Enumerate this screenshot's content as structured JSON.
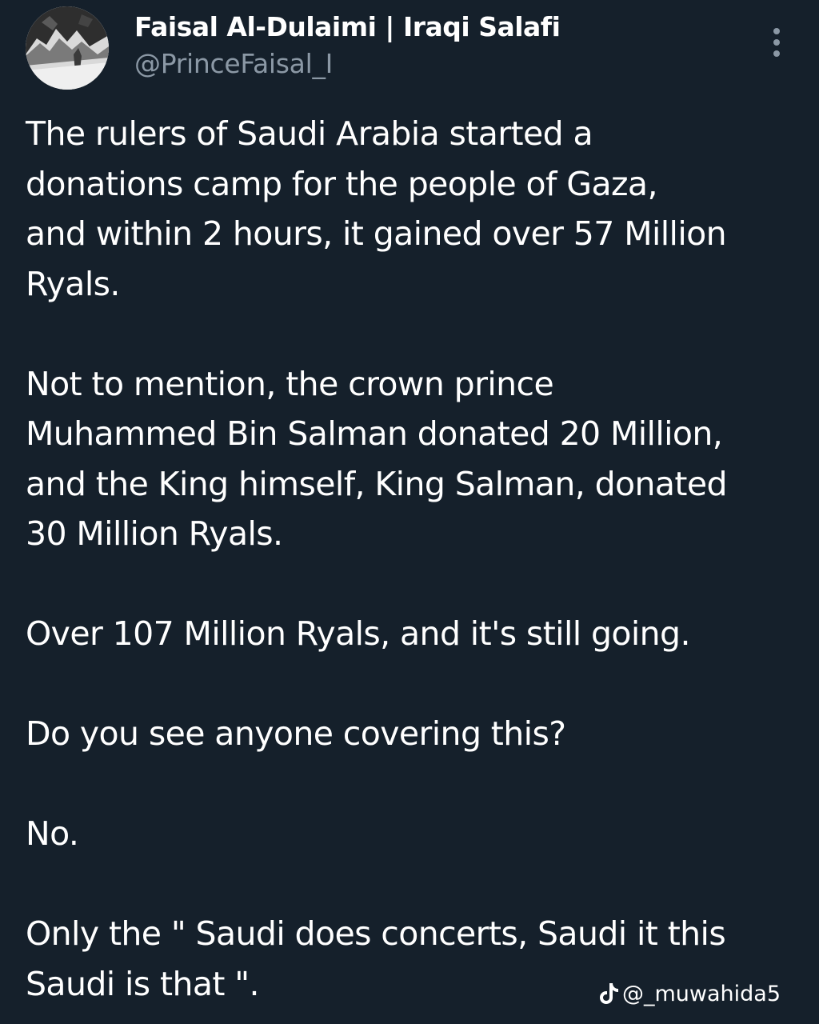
{
  "author": {
    "display_name": "Faisal Al-Dulaimi | Iraqi Salafi",
    "handle": "@PrinceFaisal_I",
    "avatar_icon": "profile-photo-icon"
  },
  "menu": {
    "icon": "more-vertical-icon"
  },
  "tweet": {
    "paragraphs": [
      "The rulers of Saudi Arabia started a\ndonations camp for the people of Gaza,\nand within 2 hours, it gained over 57 Million\nRyals.",
      "Not to mention, the crown prince\nMuhammed Bin Salman donated 20 Million,\nand the King himself, King Salman, donated\n30 Million Ryals.",
      "Over 107 Million Ryals, and it's still going.",
      "Do you see anyone covering this?",
      "No.",
      "Only the \" Saudi does concerts, Saudi it this\nSaudi is that \"."
    ]
  },
  "watermark": {
    "icon": "tiktok-icon",
    "text": "@_muwahida5"
  },
  "colors": {
    "background": "#15202b",
    "text": "#ffffff",
    "secondary_text": "#8b98a5"
  }
}
